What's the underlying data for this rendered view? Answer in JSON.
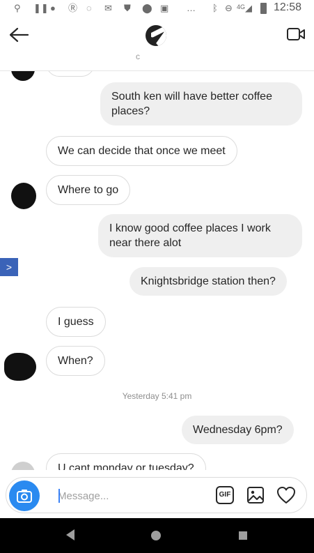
{
  "status_bar": {
    "time": "12:58",
    "network": "4G",
    "more": "…"
  },
  "header": {
    "back_icon": "arrow-left-icon",
    "video_icon": "video-camera-icon",
    "subtext": "c"
  },
  "messages": [
    {
      "side": "out",
      "text": "South ken will have better coffee places?"
    },
    {
      "side": "in",
      "text": "We can decide that once we meet"
    },
    {
      "side": "in",
      "text": "Where to go"
    },
    {
      "side": "out",
      "text": "I know good coffee places I work near there alot"
    },
    {
      "side": "out",
      "text": "Knightsbridge station then?"
    },
    {
      "side": "in",
      "text": "I guess"
    },
    {
      "side": "in",
      "text": "When?"
    },
    {
      "side": "out",
      "text": "Wednesday 6pm?"
    },
    {
      "side": "in",
      "text": "U cant monday or tuesday?"
    }
  ],
  "timestamp": "Yesterday 5:41 pm",
  "side_tab": ">",
  "composer": {
    "placeholder": "Message...",
    "gif_label": "GIF",
    "camera_icon": "camera-icon",
    "gallery_icon": "image-gallery-icon",
    "heart_icon": "heart-icon"
  },
  "colors": {
    "accent_blue": "#2a8af0",
    "bubble_out": "#efefef",
    "bubble_in_border": "#dbdbdb"
  }
}
